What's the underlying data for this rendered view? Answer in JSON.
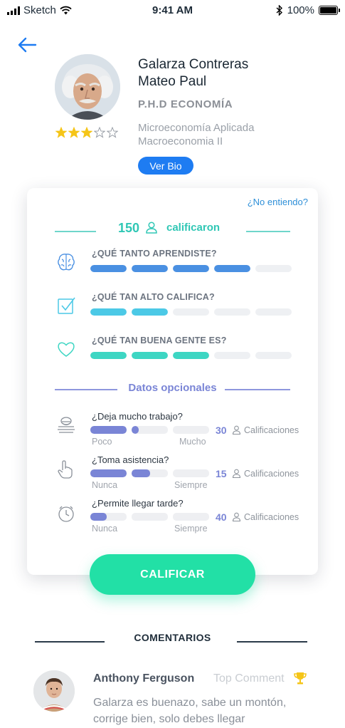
{
  "status_bar": {
    "carrier": "Sketch",
    "time": "9:41 AM",
    "battery": "100%"
  },
  "professor": {
    "surnames": "Galarza Contreras",
    "given_names": "Mateo Paul",
    "degree": "P.H.D ECONOMÍA",
    "courses": [
      "Microeconomía Aplicada",
      "Macroeconomia II"
    ],
    "stars": 3,
    "stars_max": 5,
    "bio_button": "Ver Bio"
  },
  "card": {
    "help_link": "¿No entiendo?",
    "rated_count": "150",
    "rated_label": "calificaron",
    "questions": [
      {
        "icon": "brain-icon",
        "label": "¿QUÉ TANTO APRENDISTE?",
        "filled": 4,
        "total": 5,
        "color": "#4a90e2"
      },
      {
        "icon": "checkbox-icon",
        "label": "¿QUÉ TAN ALTO CALIFICA?",
        "filled": 2,
        "total": 5,
        "color": "#4cc9e6"
      },
      {
        "icon": "heart-icon",
        "label": "¿QUÉ TAN BUENA GENTE ES?",
        "filled": 3,
        "total": 5,
        "color": "#3dd6c3"
      }
    ],
    "optional_title": "Datos opcionales",
    "optional": [
      {
        "icon": "workload-icon",
        "question": "¿Deja mucho trabajo?",
        "level": 0.4,
        "low": "Poco",
        "high": "Mucho",
        "count": "30",
        "count_label": "Calificaciones"
      },
      {
        "icon": "hand-icon",
        "question": "¿Toma asistencia?",
        "level": 0.5,
        "low": "Nunca",
        "high": "Siempre",
        "count": "15",
        "count_label": "Calificaciones"
      },
      {
        "icon": "clock-icon",
        "question": "¿Permite llegar tarde?",
        "level": 0.15,
        "low": "Nunca",
        "high": "Siempre",
        "count": "40",
        "count_label": "Calificaciones"
      }
    ],
    "cta": "CALIFICAR"
  },
  "comments": {
    "title": "COMENTARIOS",
    "items": [
      {
        "author": "Anthony Ferguson",
        "badge": "Top Comment",
        "text": "Galarza es buenazo, sabe un montón, corrige bien, solo debes llegar"
      }
    ]
  },
  "colors": {
    "accent_blue": "#1e7cf2",
    "teal": "#30c7b5",
    "indigo": "#7a85d6",
    "cta_green": "#22e0a6",
    "star": "#f5c518"
  }
}
